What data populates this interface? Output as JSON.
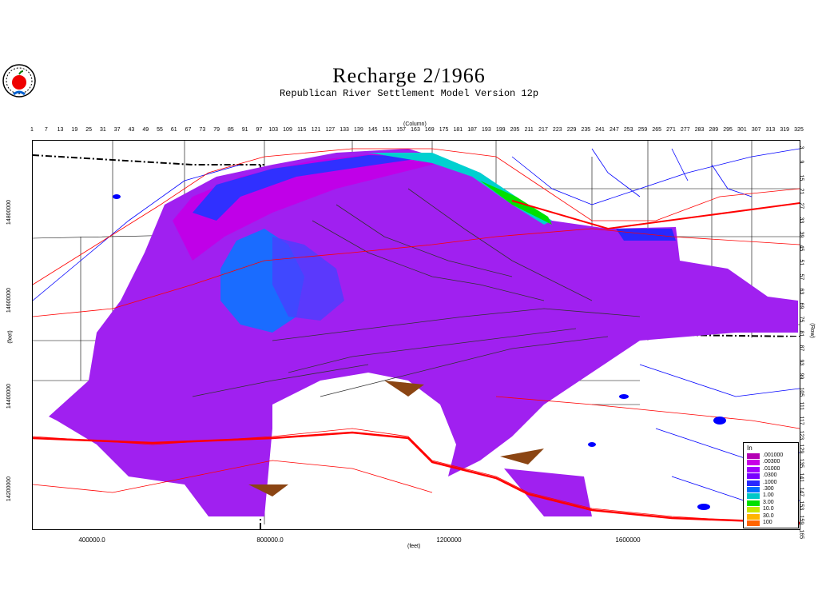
{
  "title": "Recharge   2/1966",
  "subtitle": "Republican River Settlement Model Version 12p",
  "column_axis_title": "(Column)",
  "column_ticks": [
    "1",
    "7",
    "13",
    "19",
    "25",
    "31",
    "37",
    "43",
    "49",
    "55",
    "61",
    "67",
    "73",
    "79",
    "85",
    "91",
    "97",
    "103",
    "109",
    "115",
    "121",
    "127",
    "133",
    "139",
    "145",
    "151",
    "157",
    "163",
    "169",
    "175",
    "181",
    "187",
    "193",
    "199",
    "205",
    "211",
    "217",
    "223",
    "229",
    "235",
    "241",
    "247",
    "253",
    "259",
    "265",
    "271",
    "277",
    "283",
    "289",
    "295",
    "301",
    "307",
    "313",
    "319",
    "325"
  ],
  "row_ticks": [
    "3",
    "9",
    "15",
    "21",
    "27",
    "33",
    "39",
    "45",
    "51",
    "57",
    "63",
    "69",
    "75",
    "81",
    "87",
    "93",
    "99",
    "105",
    "111",
    "117",
    "123",
    "129",
    "135",
    "141",
    "147",
    "153",
    "159",
    "165"
  ],
  "row_axis_title": "(Row)",
  "y_axis_title": "(feet)",
  "y_ticks": [
    "14800000",
    "14600000",
    "14400000",
    "14200000"
  ],
  "x_axis_title": "(feet)",
  "x_ticks": [
    "400000.0",
    "800000.0",
    "1200000",
    "1600000"
  ],
  "legend": {
    "unit": "In",
    "entries": [
      {
        "label": ".001000",
        "color": "#b400b4"
      },
      {
        "label": ".00300",
        "color": "#c800e6"
      },
      {
        "label": ".01000",
        "color": "#a000ff"
      },
      {
        "label": ".0300",
        "color": "#7800ff"
      },
      {
        "label": ".1000",
        "color": "#2828ff"
      },
      {
        "label": ".300",
        "color": "#0070ff"
      },
      {
        "label": "1.00",
        "color": "#00c8c8"
      },
      {
        "label": "3.00",
        "color": "#00e000"
      },
      {
        "label": "10.0",
        "color": "#c8e600"
      },
      {
        "label": "30.0",
        "color": "#ffb400"
      },
      {
        "label": "100",
        "color": "#ff6400"
      }
    ]
  },
  "colors": {
    "river": "#0000ff",
    "road": "#ff0000",
    "boundary": "#000000",
    "low_recharge": "#a020f0",
    "brown_cells": "#8b4513"
  }
}
